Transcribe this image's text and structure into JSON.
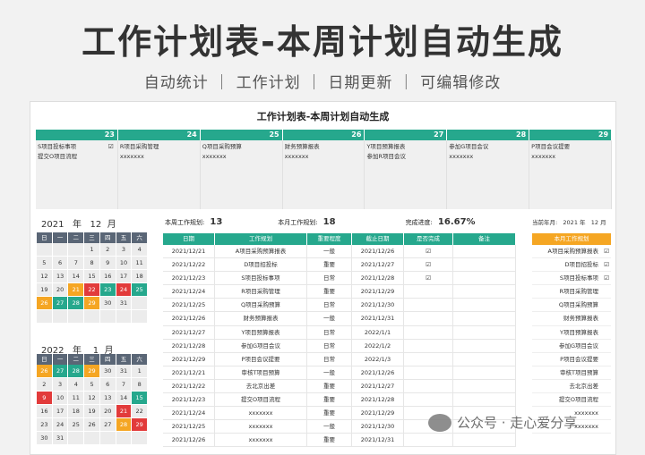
{
  "banner": {
    "title": "工作计划表-本周计划自动生成",
    "subtitle": "自动统计 ｜ 工作计划 ｜ 日期更新 ｜ 可编辑修改"
  },
  "sheet_title": "工作计划表-本周计划自动生成",
  "week": {
    "days": [
      "23",
      "24",
      "25",
      "26",
      "27",
      "28",
      "29"
    ],
    "columns": [
      {
        "tasks": [
          "S项目投标事项",
          "提交O项目流程"
        ],
        "check": "☑"
      },
      {
        "tasks": [
          "R项目采购管理",
          "xxxxxxx"
        ],
        "check": ""
      },
      {
        "tasks": [
          "Q项目采购预算",
          "xxxxxxx"
        ],
        "check": ""
      },
      {
        "tasks": [
          "财务预算报表",
          "xxxxxxx"
        ],
        "check": ""
      },
      {
        "tasks": [
          "Y项目预算报表",
          "参加R项目会议"
        ],
        "check": ""
      },
      {
        "tasks": [
          "参加G项目会议",
          "xxxxxxx"
        ],
        "check": ""
      },
      {
        "tasks": [
          "P项目会议提要",
          "xxxxxxx"
        ],
        "check": ""
      }
    ]
  },
  "calendar_2021": {
    "year": "2021",
    "year_label": "年",
    "month": "12",
    "month_label": "月"
  },
  "calendar_2022": {
    "year": "2022",
    "year_label": "年",
    "month": "1",
    "month_label": "月"
  },
  "weekdays": [
    "日",
    "一",
    "二",
    "三",
    "四",
    "五",
    "六"
  ],
  "stats": {
    "week_plan_label": "本周工作规划:",
    "week_plan_value": "13",
    "month_plan_label": "本月工作规划:",
    "month_plan_value": "18",
    "progress_label": "完成进度:",
    "progress_value": "16.67%"
  },
  "side": {
    "current_label": "当前年月:",
    "current_year": "2021",
    "current_year_label": "年",
    "current_month": "12",
    "current_month_label": "月",
    "header": "本月工作规划",
    "items": [
      {
        "t": "A项目采购预算报表",
        "c": "☑"
      },
      {
        "t": "D项目招投标",
        "c": "☑"
      },
      {
        "t": "S项目投标事项",
        "c": "☑"
      },
      {
        "t": "R项目采购管理",
        "c": ""
      },
      {
        "t": "Q项目采购预算",
        "c": ""
      },
      {
        "t": "财务预算报表",
        "c": ""
      },
      {
        "t": "Y项目预算报表",
        "c": ""
      },
      {
        "t": "参加G项目会议",
        "c": ""
      },
      {
        "t": "P项目会议提要",
        "c": ""
      },
      {
        "t": "审核T项目预算",
        "c": ""
      },
      {
        "t": "去北京出差",
        "c": ""
      },
      {
        "t": "提交O项目流程",
        "c": ""
      },
      {
        "t": "xxxxxxx",
        "c": ""
      },
      {
        "t": "xxxxxxx",
        "c": ""
      }
    ]
  },
  "table": {
    "headers": [
      "日期",
      "工作规划",
      "重要程度",
      "截止日期",
      "是否完成",
      "备注"
    ],
    "rows": [
      [
        "2021/12/21",
        "A项目采购预算报表",
        "一般",
        "2021/12/26",
        "☑",
        ""
      ],
      [
        "2021/12/22",
        "D项目招投标",
        "重要",
        "2021/12/27",
        "☑",
        ""
      ],
      [
        "2021/12/23",
        "S项目投标事项",
        "日常",
        "2021/12/28",
        "☑",
        ""
      ],
      [
        "2021/12/24",
        "R项目采购管理",
        "重要",
        "2021/12/29",
        "",
        ""
      ],
      [
        "2021/12/25",
        "Q项目采购预算",
        "日常",
        "2021/12/30",
        "",
        ""
      ],
      [
        "2021/12/26",
        "财务预算报表",
        "一般",
        "2021/12/31",
        "",
        ""
      ],
      [
        "2021/12/27",
        "Y项目预算报表",
        "日常",
        "2022/1/1",
        "",
        ""
      ],
      [
        "2021/12/28",
        "参加G项目会议",
        "日常",
        "2022/1/2",
        "",
        ""
      ],
      [
        "2021/12/29",
        "P项目会议提要",
        "日常",
        "2022/1/3",
        "",
        ""
      ],
      [
        "2021/12/21",
        "审核T项目预算",
        "一般",
        "2021/12/26",
        "",
        ""
      ],
      [
        "2021/12/22",
        "去北京出差",
        "重要",
        "2021/12/27",
        "",
        ""
      ],
      [
        "2021/12/23",
        "提交O项目流程",
        "重要",
        "2021/12/28",
        "",
        ""
      ],
      [
        "2021/12/24",
        "xxxxxxx",
        "重要",
        "2021/12/29",
        "",
        ""
      ],
      [
        "2021/12/25",
        "xxxxxxx",
        "一般",
        "2021/12/30",
        "",
        ""
      ],
      [
        "2021/12/26",
        "xxxxxxx",
        "重要",
        "2021/12/31",
        "",
        ""
      ]
    ]
  },
  "cal1_rows": [
    [
      [
        "",
        ""
      ],
      [
        "",
        ""
      ],
      [
        "",
        ""
      ],
      [
        "1",
        ""
      ],
      [
        "2",
        ""
      ],
      [
        "3",
        ""
      ],
      [
        "4",
        ""
      ]
    ],
    [
      [
        "5",
        ""
      ],
      [
        "6",
        ""
      ],
      [
        "7",
        ""
      ],
      [
        "8",
        ""
      ],
      [
        "9",
        ""
      ],
      [
        "10",
        ""
      ],
      [
        "11",
        ""
      ]
    ],
    [
      [
        "12",
        ""
      ],
      [
        "13",
        ""
      ],
      [
        "14",
        ""
      ],
      [
        "15",
        ""
      ],
      [
        "16",
        ""
      ],
      [
        "17",
        ""
      ],
      [
        "18",
        ""
      ]
    ],
    [
      [
        "19",
        ""
      ],
      [
        "20",
        ""
      ],
      [
        "21",
        "o"
      ],
      [
        "22",
        "r"
      ],
      [
        "23",
        "g"
      ],
      [
        "24",
        "r"
      ],
      [
        "25",
        "g"
      ]
    ],
    [
      [
        "26",
        "o"
      ],
      [
        "27",
        "g"
      ],
      [
        "28",
        "g"
      ],
      [
        "29",
        "o"
      ],
      [
        "30",
        ""
      ],
      [
        "31",
        ""
      ],
      [
        "",
        ""
      ]
    ],
    [
      [
        "",
        ""
      ],
      [
        "",
        ""
      ],
      [
        "",
        ""
      ],
      [
        "",
        ""
      ],
      [
        "",
        ""
      ],
      [
        "",
        ""
      ],
      [
        "",
        ""
      ]
    ]
  ],
  "cal2_rows": [
    [
      [
        "26",
        "o"
      ],
      [
        "27",
        "g"
      ],
      [
        "28",
        "g"
      ],
      [
        "29",
        "o"
      ],
      [
        "30",
        ""
      ],
      [
        "31",
        ""
      ],
      [
        "1",
        ""
      ]
    ],
    [
      [
        "2",
        ""
      ],
      [
        "3",
        ""
      ],
      [
        "4",
        ""
      ],
      [
        "5",
        ""
      ],
      [
        "6",
        ""
      ],
      [
        "7",
        ""
      ],
      [
        "8",
        ""
      ]
    ],
    [
      [
        "9",
        "r"
      ],
      [
        "10",
        ""
      ],
      [
        "11",
        ""
      ],
      [
        "12",
        ""
      ],
      [
        "13",
        ""
      ],
      [
        "14",
        ""
      ],
      [
        "15",
        "g"
      ]
    ],
    [
      [
        "16",
        ""
      ],
      [
        "17",
        ""
      ],
      [
        "18",
        ""
      ],
      [
        "19",
        ""
      ],
      [
        "20",
        ""
      ],
      [
        "21",
        "r"
      ],
      [
        "22",
        ""
      ]
    ],
    [
      [
        "23",
        ""
      ],
      [
        "24",
        ""
      ],
      [
        "25",
        ""
      ],
      [
        "26",
        ""
      ],
      [
        "27",
        ""
      ],
      [
        "28",
        "o"
      ],
      [
        "29",
        "r"
      ]
    ],
    [
      [
        "30",
        ""
      ],
      [
        "31",
        ""
      ],
      [
        "",
        ""
      ],
      [
        "",
        ""
      ],
      [
        "",
        ""
      ],
      [
        "",
        ""
      ],
      [
        "",
        ""
      ]
    ]
  ],
  "watermark": "公众号 · 走心爱分享"
}
